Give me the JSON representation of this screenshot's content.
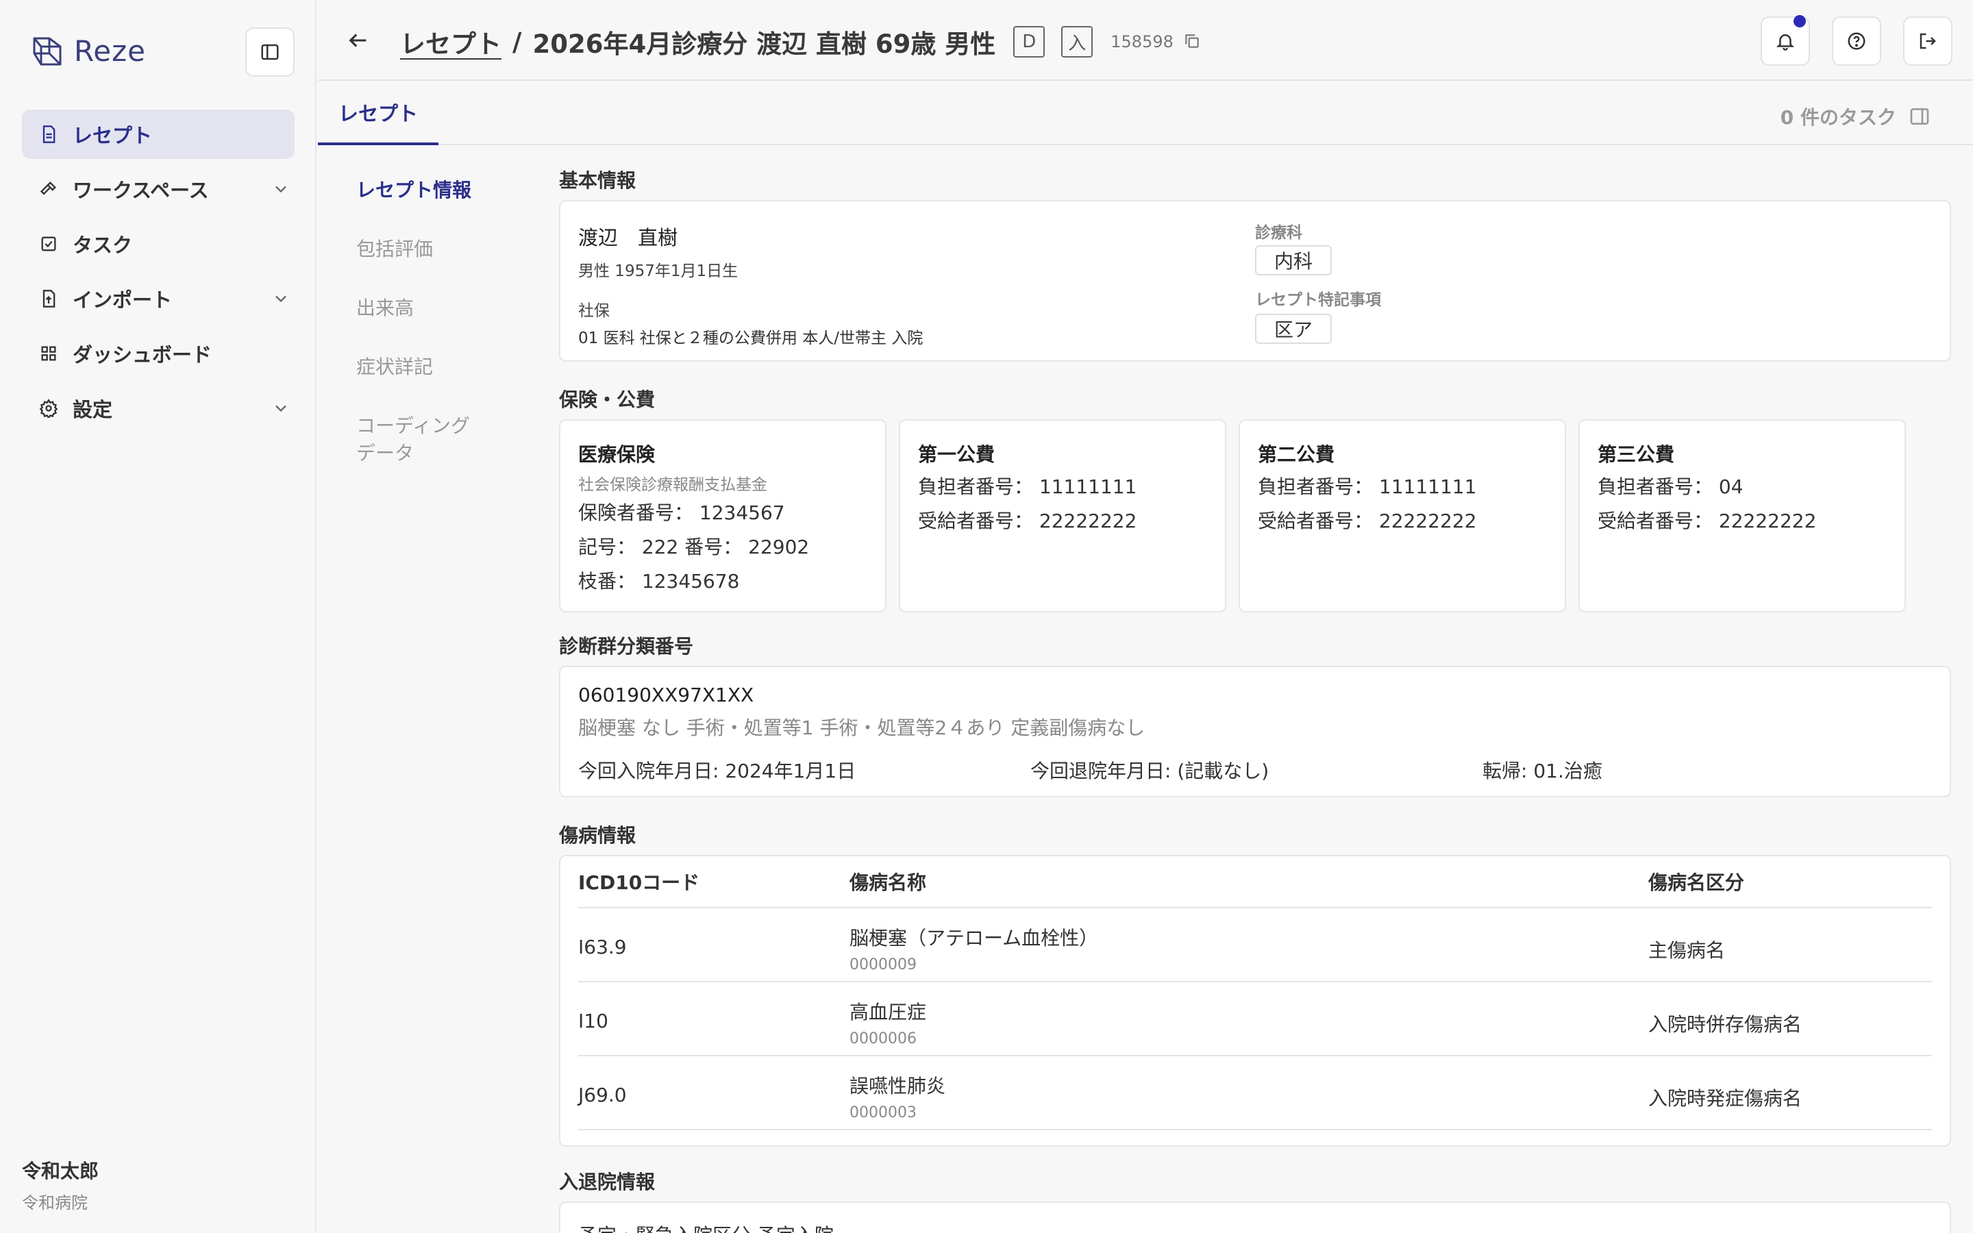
{
  "app": {
    "name": "Reze"
  },
  "sidebar": {
    "items": [
      {
        "label": "レセプト",
        "icon": "file-icon",
        "active": true,
        "expandable": false
      },
      {
        "label": "ワークスペース",
        "icon": "hammer-icon",
        "active": false,
        "expandable": true
      },
      {
        "label": "タスク",
        "icon": "checkbox-icon",
        "active": false,
        "expandable": false
      },
      {
        "label": "インポート",
        "icon": "file-import-icon",
        "active": false,
        "expandable": true
      },
      {
        "label": "ダッシュボード",
        "icon": "grid-icon",
        "active": false,
        "expandable": false
      },
      {
        "label": "設定",
        "icon": "gear-icon",
        "active": false,
        "expandable": true
      }
    ],
    "user": {
      "name": "令和太郎",
      "org": "令和病院"
    }
  },
  "header": {
    "crumb": "レセプト",
    "separator": "/",
    "title": "2026年4月診療分 渡辺 直樹 69歳 男性",
    "tag1": "D",
    "tag2": "入",
    "id": "158598"
  },
  "tabs": {
    "active": "レセプト",
    "task_count": "0 件のタスク"
  },
  "subnav": [
    "レセプト情報",
    "包括評価",
    "出来高",
    "症状詳記",
    "コーディング\nデータ"
  ],
  "basic": {
    "title": "基本情報",
    "name": "渡辺　直樹",
    "sex_birth": "男性 1957年1月1日生",
    "insurance_label": "社保",
    "insurance_detail": "01 医科 社保と２種の公費併用 本人/世帯主 入院",
    "dept_label": "診療科",
    "dept": "内科",
    "note_label": "レセプト特記事項",
    "note": "区ア"
  },
  "insurance": {
    "title": "保険・公費",
    "cards": [
      {
        "title": "医療保険",
        "sub": "社会保険診療報酬支払基金",
        "lines": [
          "保険者番号： 1234567",
          "記号： 222  番号： 22902",
          "枝番： 12345678"
        ]
      },
      {
        "title": "第一公費",
        "sub": "",
        "lines": [
          "負担者番号： 11111111",
          "受給者番号： 22222222"
        ]
      },
      {
        "title": "第二公費",
        "sub": "",
        "lines": [
          "負担者番号： 11111111",
          "受給者番号： 22222222"
        ]
      },
      {
        "title": "第三公費",
        "sub": "",
        "lines": [
          "負担者番号： 04",
          "受給者番号： 22222222"
        ]
      }
    ]
  },
  "dpc": {
    "title": "診断群分類番号",
    "code": "060190XX97X1XX",
    "desc": "脳梗塞 なし 手術・処置等1 手術・処置等2４あり 定義副傷病なし",
    "admission": "今回入院年月日:  2024年1月1日",
    "discharge": "今回退院年月日:  (記載なし)",
    "outcome": "転帰:  01.治癒"
  },
  "diseases": {
    "title": "傷病情報",
    "headers": [
      "ICD10コード",
      "傷病名称",
      "傷病名区分"
    ],
    "rows": [
      {
        "code": "I63.9",
        "name": "脳梗塞（アテローム血栓性）",
        "sub": "0000009",
        "kind": "主傷病名"
      },
      {
        "code": "I10",
        "name": "高血圧症",
        "sub": "0000006",
        "kind": "入院時併存傷病名"
      },
      {
        "code": "J69.0",
        "name": "誤嚥性肺炎",
        "sub": "0000003",
        "kind": "入院時発症傷病名"
      }
    ]
  },
  "admission": {
    "title": "入退院情報",
    "text": "予定・緊急入院区分  予定入院"
  }
}
